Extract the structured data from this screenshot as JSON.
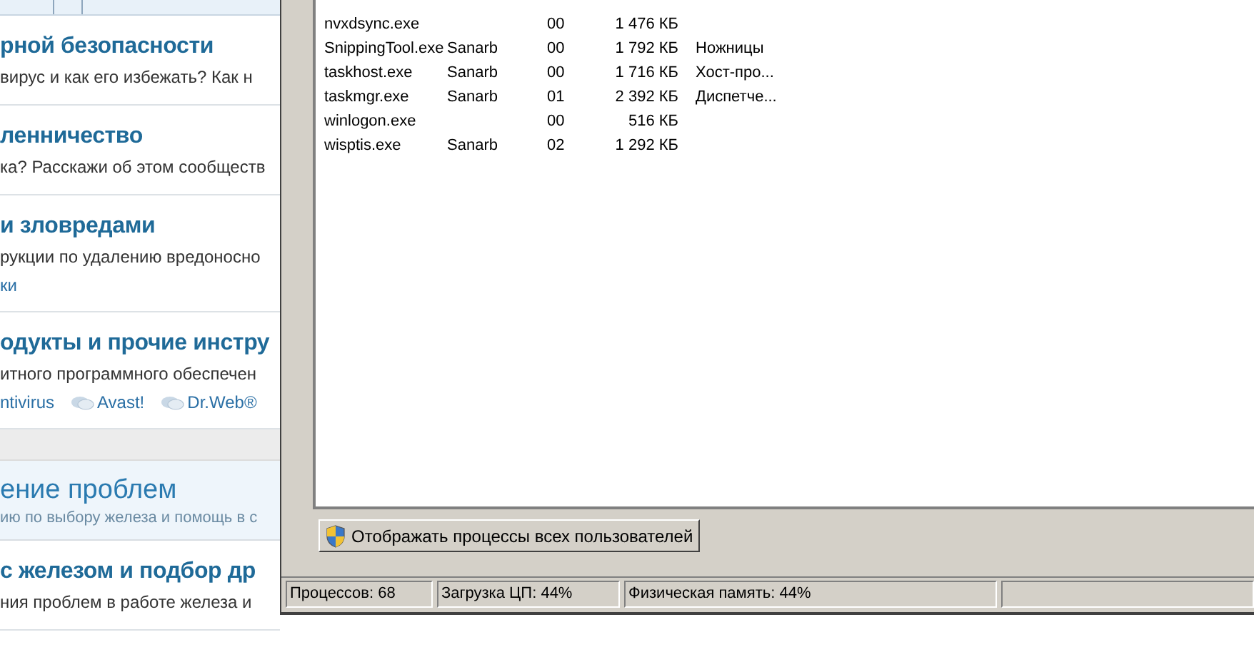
{
  "web_page": {
    "sections": [
      {
        "kind": "forum",
        "title": "рной безопасности",
        "description": "вирус и как его избежать? Как н"
      },
      {
        "kind": "forum",
        "title": "ленничество",
        "description": "ка? Расскажи об этом сообществ"
      },
      {
        "kind": "forum",
        "title": "и зловредами",
        "description": "рукции по удалению вредоносно",
        "links": [
          {
            "label": "ки",
            "icon": false
          }
        ]
      },
      {
        "kind": "forum",
        "title": "одукты и прочие инстру",
        "description": "итного программного обеспечен",
        "links": [
          {
            "label": "ntivirus",
            "icon": false
          },
          {
            "label": "Avast!",
            "icon": true
          },
          {
            "label": "Dr.Web®",
            "icon": true
          }
        ]
      },
      {
        "kind": "category",
        "title": "ение проблем",
        "description": "ию по выбору железа и помощь в с"
      },
      {
        "kind": "forum",
        "title": "с железом и подбор др",
        "description": "ния проблем в работе железа и"
      }
    ]
  },
  "task_manager": {
    "processes": [
      {
        "name": "nvxdsync.exe",
        "cpu": "00",
        "memory": "1 476 КБ"
      },
      {
        "name": "SnippingTool.exe",
        "user": "Sanarb",
        "cpu": "00",
        "memory": "1 792 КБ",
        "description": "Ножницы"
      },
      {
        "name": "taskhost.exe",
        "user": "Sanarb",
        "cpu": "00",
        "memory": "1 716 КБ",
        "description": "Хост-про..."
      },
      {
        "name": "taskmgr.exe",
        "user": "Sanarb",
        "cpu": "01",
        "memory": "2 392 КБ",
        "description": "Диспетче..."
      },
      {
        "name": "winlogon.exe",
        "cpu": "00",
        "memory": "516 КБ"
      },
      {
        "name": "wisptis.exe",
        "user": "Sanarb",
        "cpu": "02",
        "memory": "1 292 КБ"
      }
    ],
    "show_all_button": "Отображать процессы всех пользователей",
    "status_bar": [
      "Процессов: 68",
      "Загрузка ЦП: 44%",
      "Физическая память: 44%"
    ]
  }
}
